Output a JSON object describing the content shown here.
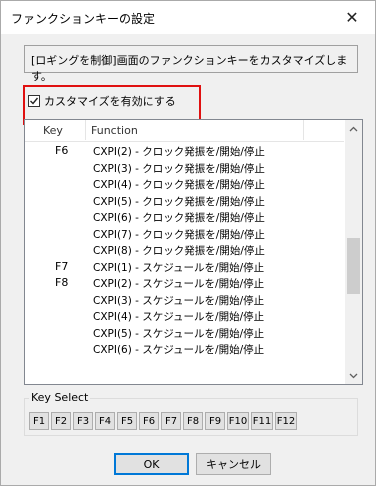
{
  "window": {
    "title": "ファンクションキーの設定",
    "close_glyph": "✕"
  },
  "description": "[ロギングを制御]画面のファンクションキーをカスタマイズします。",
  "customize_checkbox": {
    "label": "カスタマイズを有効にする",
    "checked": true
  },
  "list": {
    "headers": {
      "key": "Key",
      "function": "Function"
    },
    "rows": [
      {
        "key": "F6",
        "function": "CXPI(2) - クロック発振を/開始/停止"
      },
      {
        "key": "",
        "function": "CXPI(3) - クロック発振を/開始/停止"
      },
      {
        "key": "",
        "function": "CXPI(4) - クロック発振を/開始/停止"
      },
      {
        "key": "",
        "function": "CXPI(5) - クロック発振を/開始/停止"
      },
      {
        "key": "",
        "function": "CXPI(6) - クロック発振を/開始/停止"
      },
      {
        "key": "",
        "function": "CXPI(7) - クロック発振を/開始/停止"
      },
      {
        "key": "",
        "function": "CXPI(8) - クロック発振を/開始/停止"
      },
      {
        "key": "F7",
        "function": "CXPI(1) - スケジュールを/開始/停止"
      },
      {
        "key": "F8",
        "function": "CXPI(2) - スケジュールを/開始/停止"
      },
      {
        "key": "",
        "function": "CXPI(3) - スケジュールを/開始/停止"
      },
      {
        "key": "",
        "function": "CXPI(4) - スケジュールを/開始/停止"
      },
      {
        "key": "",
        "function": "CXPI(5) - スケジュールを/開始/停止"
      },
      {
        "key": "",
        "function": "CXPI(6) - スケジュールを/開始/停止"
      }
    ]
  },
  "key_select": {
    "label": "Key Select",
    "keys": [
      "F1",
      "F2",
      "F3",
      "F4",
      "F5",
      "F6",
      "F7",
      "F8",
      "F9",
      "F10",
      "F11",
      "F12"
    ]
  },
  "buttons": {
    "ok": "OK",
    "cancel": "キャンセル"
  },
  "colors": {
    "highlight": "#e01010",
    "default_button_border": "#0078d7"
  }
}
